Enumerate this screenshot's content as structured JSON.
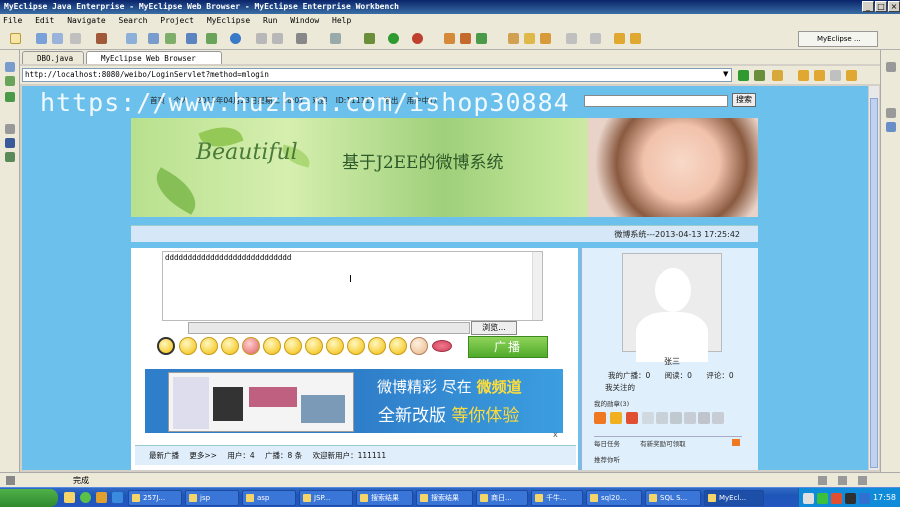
{
  "window": {
    "title": "MyEclipse Java Enterprise - MyEclipse Web Browser - MyEclipse Enterprise Workbench",
    "minimize": "_",
    "maximize": "□",
    "close": "×"
  },
  "menu": [
    "File",
    "Edit",
    "Navigate",
    "Search",
    "Project",
    "MyEclipse",
    "Run",
    "Window",
    "Help"
  ],
  "perspective": {
    "label": "MyEclipse ..."
  },
  "tabs": [
    {
      "label": "DBO.java"
    },
    {
      "label": "MyEclipse Web Browser"
    }
  ],
  "url": "http://localhost:8080/weibo/LoginServlet?method=mlogin",
  "watermark": "https://www.huzhan.com/ishop30884",
  "site": {
    "nav": [
      "首页",
      "个人",
      "2013年04月23日星期二 18:07",
      "欢迎",
      "ID:111111",
      "退出",
      "用户中心"
    ],
    "search_button": "搜索",
    "banner_script": "Beautiful",
    "banner_title": "基于J2EE的微博系统",
    "info": "微博系统---2013-04-13 17:25:42",
    "post_text": "dddddddddddddddddddddddddddd",
    "browse_button": "浏览...",
    "broadcast_button": "广播",
    "ad": {
      "line1_a": "微博精彩 尽在",
      "line1_b": "微频道",
      "line2_a": "全新改版",
      "line2_b": "等你体验",
      "close": "x"
    },
    "stats": {
      "latest": "最新广播",
      "more": "更多>>",
      "users": "用户：4",
      "broadcasts": "广播：8 条",
      "new_user": "欢迎新用户：111111"
    },
    "profile": {
      "name": "张三",
      "my_broadcasts": "我的广播：0",
      "reads": "阅读：0",
      "comments": "评论：0",
      "following": "我关注的",
      "medals": "我的勋章(3)",
      "daily_task": "每日任务",
      "daily_reward": "有新奖励可领取",
      "recommend": "推荐你听"
    }
  },
  "status": {
    "text": "完成"
  },
  "taskbar": {
    "tasks": [
      "257J...",
      "jsp",
      "asp",
      "JSP...",
      "搜索结果",
      "搜索结果",
      "商日...",
      "千牛...",
      "sql20...",
      "SQL S...",
      "MyEcl..."
    ],
    "clock": "17:58"
  },
  "colors": {
    "page_bg": "#6cc0ec",
    "accent_green": "#4faa2a",
    "titlebar": "#0a246a"
  }
}
